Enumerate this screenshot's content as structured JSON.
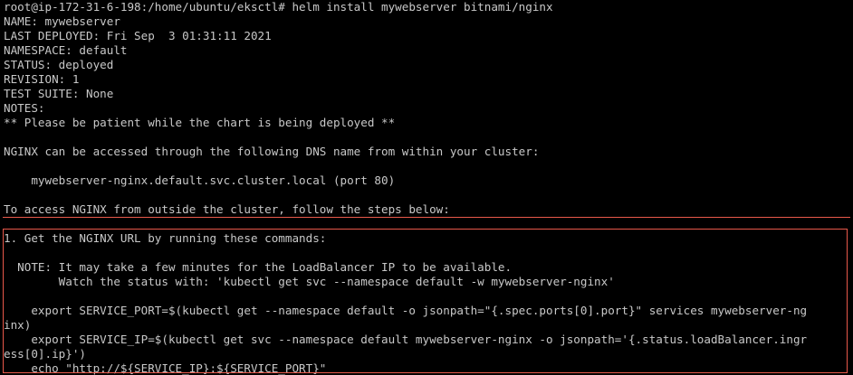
{
  "terminal": {
    "lines": [
      "root@ip-172-31-6-198:/home/ubuntu/eksctl# helm install mywebserver bitnami/nginx",
      "NAME: mywebserver",
      "LAST DEPLOYED: Fri Sep  3 01:31:11 2021",
      "NAMESPACE: default",
      "STATUS: deployed",
      "REVISION: 1",
      "TEST SUITE: None",
      "NOTES:",
      "** Please be patient while the chart is being deployed **",
      "",
      "NGINX can be accessed through the following DNS name from within your cluster:",
      "",
      "    mywebserver-nginx.default.svc.cluster.local (port 80)",
      "",
      "To access NGINX from outside the cluster, follow the steps below:",
      "",
      "1. Get the NGINX URL by running these commands:",
      "",
      "  NOTE: It may take a few minutes for the LoadBalancer IP to be available.",
      "        Watch the status with: 'kubectl get svc --namespace default -w mywebserver-nginx'",
      "",
      "    export SERVICE_PORT=$(kubectl get --namespace default -o jsonpath=\"{.spec.ports[0].port}\" services mywebserver-ng",
      "inx)",
      "    export SERVICE_IP=$(kubectl get svc --namespace default mywebserver-nginx -o jsonpath='{.status.loadBalancer.ingr",
      "ess[0].ip}')",
      "    echo \"http://${SERVICE_IP}:${SERVICE_PORT}\""
    ]
  }
}
